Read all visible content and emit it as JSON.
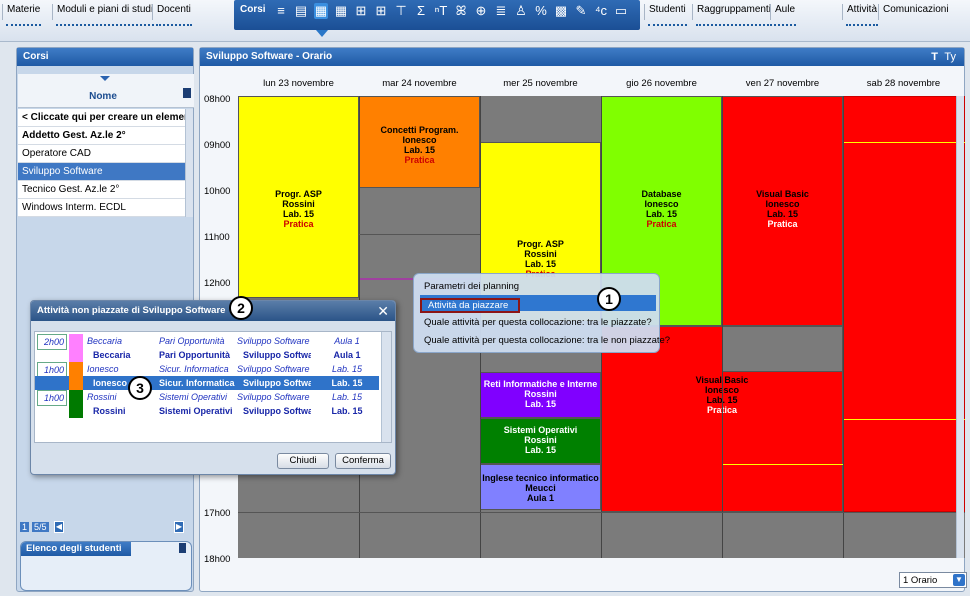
{
  "topnav": {
    "items": [
      "Materie",
      "Moduli e piani di studi",
      "Docenti"
    ],
    "active_label": "Corsi",
    "active_icons": [
      "list-icon",
      "split-icon",
      "planning-icon",
      "grid-icon",
      "table-icon",
      "table2-icon",
      "filter-icon",
      "sum-icon",
      "text-filter-icon",
      "people-icon",
      "globe-icon",
      "lines-icon",
      "person-icon",
      "percent-icon",
      "calendar-icon",
      "pen-icon",
      "hat-icon",
      "rooms-icon"
    ],
    "right_items": [
      "Studenti",
      "Raggruppamenti",
      "Aule",
      "Attività",
      "Comunicazioni"
    ]
  },
  "left": {
    "title": "Corsi",
    "col_header": "Nome",
    "rows": [
      {
        "label": "< Cliccate qui per creare un elemento >",
        "bold": true
      },
      {
        "label": "Addetto Gest. Az.le 2°",
        "bold": true
      },
      {
        "label": "Operatore CAD",
        "bold": false
      },
      {
        "label": "Sviluppo Software",
        "bold": false,
        "selected": true
      },
      {
        "label": "Tecnico Gest. Az.le 2°",
        "bold": false
      },
      {
        "label": "Windows Interm. ECDL",
        "bold": false
      }
    ],
    "pager": "5/5",
    "pager_first": "1",
    "students_title": "Elenco degli studenti"
  },
  "main": {
    "title": "Sviluppo Software - Orario",
    "days": [
      "lun 23 novembre",
      "mar 24 novembre",
      "mer 25 novembre",
      "gio 26 novembre",
      "ven 27 novembre",
      "sab 28 novembre"
    ],
    "hours": [
      "08h00",
      "09h00",
      "10h00",
      "11h00",
      "12h00",
      "17h00",
      "18h00"
    ],
    "events": {
      "e1": [
        "Progr. ASP",
        "Rossini",
        "Lab. 15",
        "Pratica"
      ],
      "e2": [
        "Concetti Program.",
        "Ionesco",
        "Lab. 15",
        "Pratica"
      ],
      "e3": [
        "Progr. ASP",
        "Rossini",
        "Lab. 15",
        "Pratica"
      ],
      "e4": [
        "Database",
        "Ionesco",
        "Lab. 15",
        "Pratica"
      ],
      "e5": [
        "Visual Basic",
        "Ionesco",
        "Lab. 15",
        "Pratica"
      ],
      "e6": [
        "Visual Basic",
        "Ionesco",
        "Lab. 15",
        "Pratica"
      ],
      "e7": [
        "Reti Informatiche e Interne",
        "Rossini",
        "Lab. 15"
      ],
      "e8": [
        "Sistemi Operativi",
        "Rossini",
        "Lab. 15"
      ],
      "e9": [
        "Inglese tecnico informatico",
        "Meucci",
        "Aula 1"
      ]
    },
    "footer_select": "1 Orario"
  },
  "context_menu": {
    "items": [
      "Parametri dei planning",
      "Attività da piazzare",
      "Quale attività per questa collocazione: tra le piazzate?",
      "Quale attività per questa collocazione: tra le non piazzate?"
    ],
    "selected_index": 1
  },
  "dialog": {
    "title": "Attività non piazzate di Sviluppo Software",
    "rows": [
      {
        "dur": "2h00",
        "c1": "Beccaria",
        "c2": "Pari Opportunità",
        "c3": "Sviluppo Software",
        "c4": "Aula 1",
        "style": "it",
        "color": "#ff80ff"
      },
      {
        "dur": "",
        "c1": "Beccaria",
        "c2": "Pari Opportunità",
        "c3": "Sviluppo Software",
        "c4": "Aula 1",
        "style": "bd",
        "color": "#ff80ff"
      },
      {
        "dur": "1h00",
        "c1": "Ionesco",
        "c2": "Sicur. Informatica",
        "c3": "Sviluppo Software",
        "c4": "Lab. 15",
        "style": "it",
        "color": "#ff8000"
      },
      {
        "dur": "",
        "c1": "Ionesco",
        "c2": "Sicur. Informatica",
        "c3": "Sviluppo Software",
        "c4": "Lab. 15",
        "style": "sel",
        "color": "#ff8000"
      },
      {
        "dur": "1h00",
        "c1": "Rossini",
        "c2": "Sistemi Operativi",
        "c3": "Sviluppo Software",
        "c4": "Lab. 15",
        "style": "it",
        "color": "#007a00"
      },
      {
        "dur": "",
        "c1": "Rossini",
        "c2": "Sistemi Operativi",
        "c3": "Sviluppo Software",
        "c4": "Lab. 15",
        "style": "bd",
        "color": "#007a00"
      }
    ],
    "close_btn": "Chiudi",
    "confirm_btn": "Conferma"
  },
  "badges": [
    "1",
    "2",
    "3"
  ],
  "colors": {
    "accent": "#1f5aa5",
    "yellow": "#ffff00",
    "orange": "#ff8000",
    "green": "#80ff00",
    "red": "#ff0000",
    "purple": "#8000ff",
    "dark_green": "#008000",
    "lavender": "#8080ff"
  }
}
